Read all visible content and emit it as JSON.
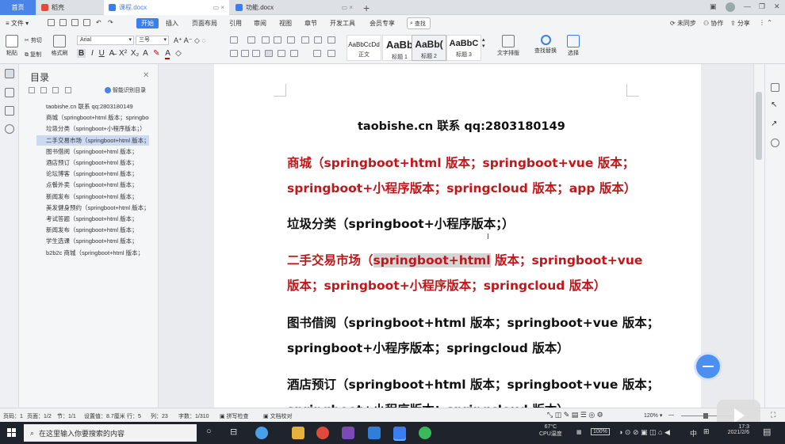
{
  "tabs": [
    {
      "label": "首页",
      "kind": "home"
    },
    {
      "label": "稻壳",
      "kind": "docer"
    },
    {
      "label": "课程.docx",
      "kind": "doc",
      "active": true
    },
    {
      "label": "功能.docx",
      "kind": "doc",
      "active": false
    }
  ],
  "menu": {
    "file": "文件",
    "items": [
      "开始",
      "插入",
      "页面布局",
      "引用",
      "审阅",
      "视图",
      "章节",
      "开发工具",
      "会员专享"
    ],
    "search": "查找",
    "right": [
      "未同步",
      "协作",
      "分享"
    ]
  },
  "ribbon": {
    "paste": "粘贴",
    "cut": "剪切",
    "copy": "复制",
    "format_painter": "格式刷",
    "font_name": "Arial",
    "font_size": "三号",
    "styles": [
      {
        "preview": "AaBbCcDd",
        "name": "正文"
      },
      {
        "preview": "AaBb",
        "name": "标题 1"
      },
      {
        "preview": "AaBb(",
        "name": "标题 2"
      },
      {
        "preview": "AaBbC",
        "name": "标题 3"
      }
    ],
    "text_layout": "文字排版",
    "find_replace": "查找替换",
    "select": "选择"
  },
  "toc": {
    "title": "目录",
    "smart": "智能识别目录",
    "items": [
      "taobishe.cn 联系 qq:2803180149",
      "商城（springboot+html 版本；springboot+vue 版本",
      "垃圾分类（springboot+小程序版本；）",
      "二手交易市场（springboot+html 版本；",
      "图书借阅（springboot+html 版本；",
      "酒店预订（springboot+html 版本；",
      "论坛博客（springboot+html 版本；",
      "点餐外卖（springboot+html 版本；",
      "新闻发布（springboot+html 版本；",
      "美发健身预约（springboot+html 版本；",
      "考试答题（springboot+html 版本；",
      "新闻发布（springboot+html 版本；",
      "学生选课（springboot+html 版本；",
      "b2b2c 商城（springboot+html 版本；"
    ],
    "highlighted_index": 3
  },
  "document": {
    "header": "taobishe.cn 联系 qq:2803180149",
    "l1": "商城（springboot+html 版本；springboot+vue 版本；",
    "l2": "springboot+小程序版本；springcloud 版本；app 版本）",
    "l3": "垃圾分类（springboot+小程序版本；）",
    "l4a": "二手交易市场（",
    "l4b": "springboot+html",
    "l4c": " 版本；springboot+vue",
    "l5": "版本；springboot+小程序版本；springcloud 版本）",
    "l6": "图书借阅（springboot+html 版本；springboot+vue 版本；",
    "l7": "springboot+小程序版本；springcloud 版本）",
    "l8": "酒店预订（springboot+html 版本；springboot+vue 版本；",
    "l9": "springboot+小程序版本；springcloud 版本）"
  },
  "status": {
    "page_no": "页码：1",
    "pages": "页面：1/2",
    "section": "节：1/1",
    "setting": "设置值：8.7厘米",
    "row": "行：5",
    "col": "列：23",
    "words": "字数：1/310",
    "spell": "拼写检查",
    "proof": "文档校对",
    "zoom": "120%"
  },
  "taskbar": {
    "search_placeholder": "在这里输入你要搜索的内容",
    "temp": "67°C",
    "cpu": "CPU温度",
    "battery": "100%",
    "ime": "中",
    "time": "17:3",
    "date": "2021/2/6"
  },
  "colors": {
    "accent": "#3a7ff2",
    "red_heading": "#c0171b",
    "selection": "#d5d5d5",
    "toc_highlight": "#cbdaf2"
  }
}
